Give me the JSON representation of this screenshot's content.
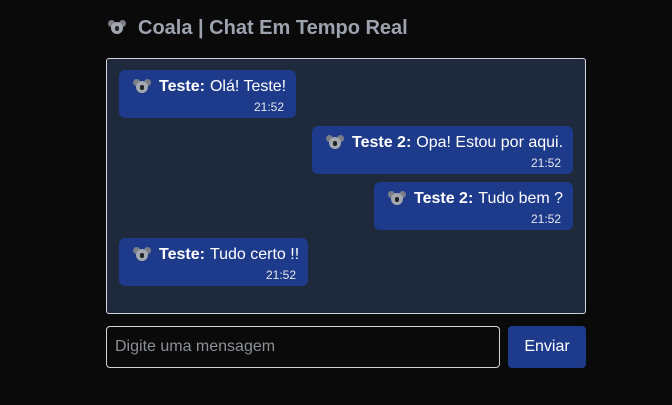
{
  "header": {
    "icon": "koala-icon",
    "title": "Coala | Chat Em Tempo Real"
  },
  "messages": [
    {
      "author": "Teste:",
      "text": "Olá! Teste!",
      "time": "21:52",
      "own": false,
      "icon": "koala-icon"
    },
    {
      "author": "Teste 2:",
      "text": "Opa! Estou por aqui.",
      "time": "21:52",
      "own": true,
      "icon": "koala-icon"
    },
    {
      "author": "Teste 2:",
      "text": "Tudo bem ?",
      "time": "21:52",
      "own": true,
      "icon": "koala-icon"
    },
    {
      "author": "Teste:",
      "text": "Tudo certo !!",
      "time": "21:52",
      "own": false,
      "icon": "koala-icon"
    }
  ],
  "composer": {
    "value": "",
    "placeholder": "Digite uma mensagem",
    "send_label": "Enviar"
  },
  "colors": {
    "background": "#0a0a0a",
    "chat_background": "#1e293b",
    "bubble": "#1e3a8a",
    "button": "#1e3a8a",
    "header_text": "#9ca3af"
  }
}
